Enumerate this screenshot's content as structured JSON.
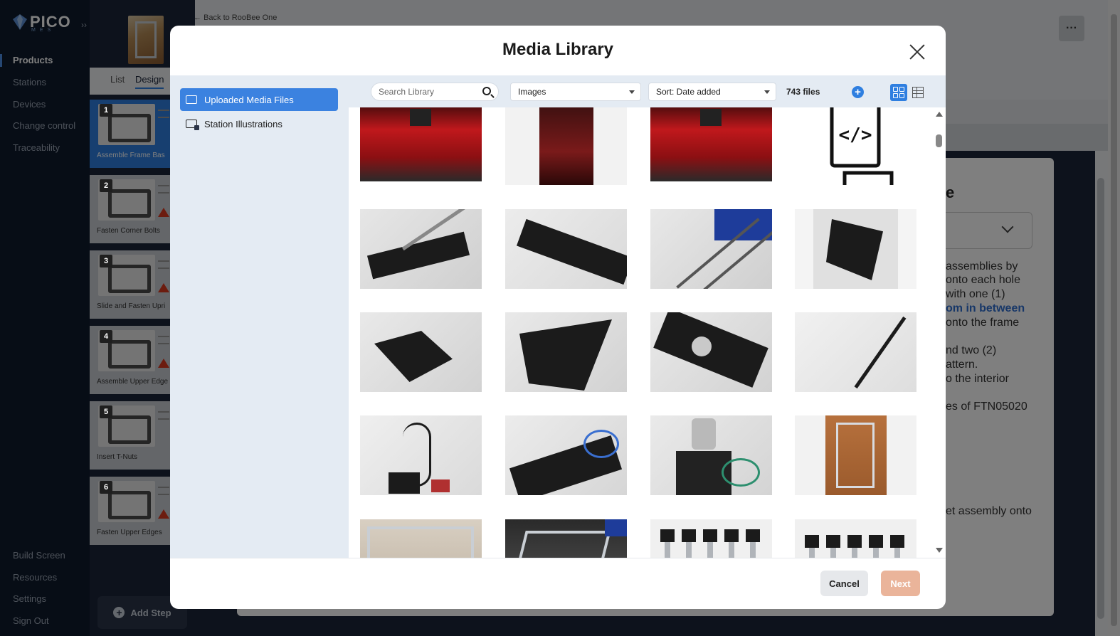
{
  "sidebar": {
    "logo_text": "PICO",
    "logo_sub": "MES",
    "nav_top": [
      {
        "label": "Products",
        "active": true
      },
      {
        "label": "Stations",
        "active": false
      },
      {
        "label": "Devices",
        "active": false
      },
      {
        "label": "Change control",
        "active": false
      },
      {
        "label": "Traceability",
        "active": false
      }
    ],
    "nav_bottom": [
      {
        "label": "Build Screen"
      },
      {
        "label": "Resources"
      },
      {
        "label": "Settings"
      },
      {
        "label": "Sign Out"
      }
    ]
  },
  "product": {
    "back_link": "Back to RooBee One",
    "tabs": [
      "List",
      "Design"
    ],
    "active_tab": "Design"
  },
  "steps": [
    {
      "num": "1",
      "label": "Assemble Frame Bas",
      "warning": false,
      "active": true
    },
    {
      "num": "2",
      "label": "Fasten Corner Bolts",
      "warning": true,
      "active": false
    },
    {
      "num": "3",
      "label": "Slide and Fasten Upri",
      "warning": true,
      "active": false
    },
    {
      "num": "4",
      "label": "Assemble Upper Edge",
      "warning": true,
      "active": false
    },
    {
      "num": "5",
      "label": "Insert T-Nuts",
      "warning": false,
      "active": false
    },
    {
      "num": "6",
      "label": "Fasten Upper Edges",
      "warning": true,
      "active": false
    }
  ],
  "add_step_label": "Add Step",
  "more_label": "···",
  "background_editor": {
    "heading": "e",
    "lines": [
      "assemblies by",
      "onto each hole",
      "with one (1)",
      "om in between",
      "onto the frame",
      "nd two (2)",
      "attern.",
      "o the interior",
      "es of FTN05020",
      "et assembly onto"
    ]
  },
  "modal": {
    "title": "Media Library",
    "folders": [
      {
        "label": "Uploaded Media Files",
        "active": true
      },
      {
        "label": "Station Illustrations",
        "active": false
      }
    ],
    "search_placeholder": "Search Library",
    "type_filter": "Images",
    "sort": "Sort: Date added",
    "file_count": "743 files",
    "add_icon": "+",
    "cancel_label": "Cancel",
    "next_label": "Next",
    "tiles": [
      "red-printer-enclosure",
      "dark-enclosure",
      "red-printer-enclosure",
      "code-document-icon",
      "black-bracket-with-rods",
      "black-bracket",
      "rods-blue-bins",
      "black-corner-bracket",
      "black-block",
      "black-corner-bracket",
      "motor-coupler-bracket",
      "black-rod",
      "cable-and-pcb",
      "bracket-blue-cables",
      "stepper-motor-coupler",
      "aluminum-frame-tower",
      "aluminum-frame-box",
      "aluminum-frame-on-desk",
      "extrusions-with-brackets",
      "extrusions-with-brackets"
    ]
  }
}
